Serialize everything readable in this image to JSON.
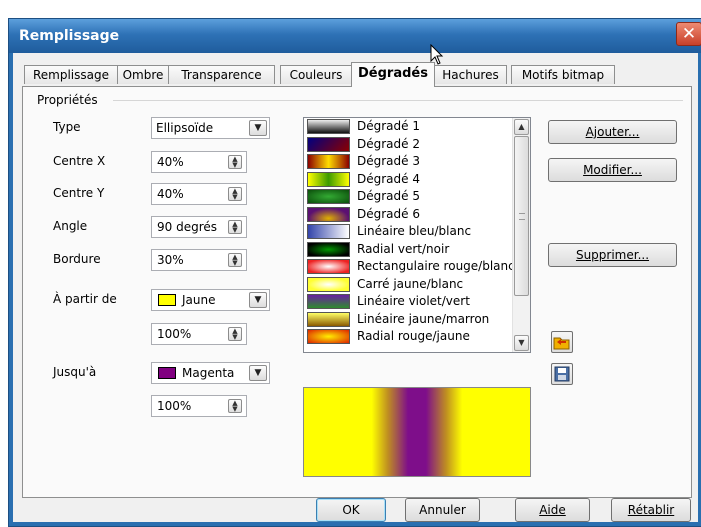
{
  "window": {
    "title": "Remplissage",
    "close_glyph": "✕"
  },
  "tabs": [
    {
      "label": "Remplissage"
    },
    {
      "label": "Ombre"
    },
    {
      "label": "Transparence"
    },
    {
      "label": "Couleurs"
    },
    {
      "label": "Dégradés",
      "active": true
    },
    {
      "label": "Hachures"
    },
    {
      "label": "Motifs bitmap"
    }
  ],
  "properties": {
    "group_label": "Propriétés",
    "type": {
      "label": "Type",
      "value": "Ellipsoïde"
    },
    "center_x": {
      "label": "Centre X",
      "value": "40%"
    },
    "center_y": {
      "label": "Centre Y",
      "value": "40%"
    },
    "angle": {
      "label": "Angle",
      "value": "90 degrés"
    },
    "border": {
      "label": "Bordure",
      "value": "30%"
    },
    "from": {
      "label": "À partir de",
      "color_name": "Jaune",
      "color": "#ffff00",
      "intensity": "100%"
    },
    "to": {
      "label": "Jusqu'à",
      "color_name": "Magenta",
      "color": "#800080",
      "intensity": "100%"
    }
  },
  "gradient_list": {
    "items": [
      {
        "label": "Dégradé 1",
        "thumb_icon": "gradient-gray-thumb"
      },
      {
        "label": "Dégradé 2",
        "thumb_icon": "gradient-blue-red-thumb"
      },
      {
        "label": "Dégradé 3",
        "thumb_icon": "gradient-red-yellow-thumb"
      },
      {
        "label": "Dégradé 4",
        "thumb_icon": "gradient-yellow-green-thumb"
      },
      {
        "label": "Dégradé 5",
        "thumb_icon": "gradient-green-thumb"
      },
      {
        "label": "Dégradé 6",
        "thumb_icon": "gradient-purple-thumb"
      },
      {
        "label": "Linéaire bleu/blanc",
        "thumb_icon": "gradient-blue-white-thumb"
      },
      {
        "label": "Radial vert/noir",
        "thumb_icon": "gradient-green-black-thumb"
      },
      {
        "label": "Rectangulaire rouge/blanc",
        "thumb_icon": "gradient-red-white-thumb"
      },
      {
        "label": "Carré jaune/blanc",
        "thumb_icon": "gradient-yellow-white-thumb"
      },
      {
        "label": "Linéaire violet/vert",
        "thumb_icon": "gradient-violet-green-thumb"
      },
      {
        "label": "Linéaire jaune/marron",
        "thumb_icon": "gradient-yellow-brown-thumb"
      },
      {
        "label": "Radial rouge/jaune",
        "thumb_icon": "gradient-red-yellow-radial-thumb"
      }
    ]
  },
  "actions": {
    "add": "Ajouter...",
    "modify": "Modifier...",
    "delete": "Supprimer...",
    "load_icon": "open-folder-icon",
    "save_icon": "save-disk-icon"
  },
  "footer": {
    "ok": "OK",
    "cancel": "Annuler",
    "help": "Aide",
    "reset": "Rétablir"
  }
}
